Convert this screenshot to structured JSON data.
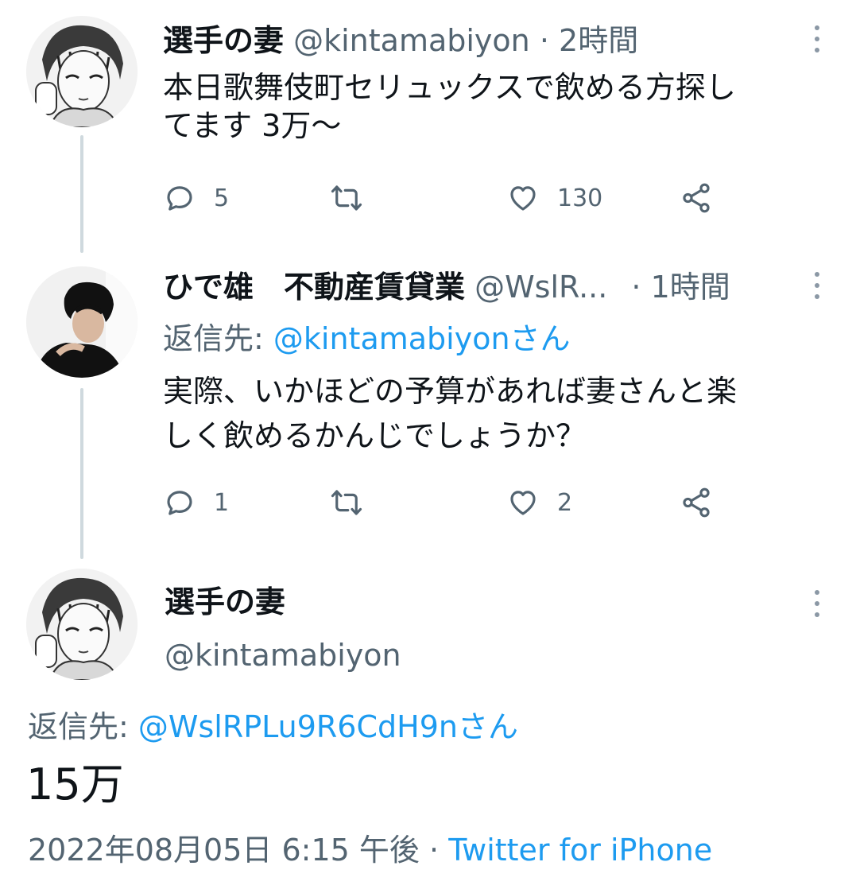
{
  "tweet1": {
    "name": "選手の妻",
    "handle": "@kintamabiyon",
    "separator": "·",
    "time": "2時間",
    "text_line1": "本日歌舞伎町セリュックスで飲める方探し",
    "text_line2": "てます 3万〜",
    "replies": "5",
    "retweets": "",
    "likes": "130"
  },
  "tweet2": {
    "name": "ひで雄　不動産賃貸業",
    "handle": "@WslR...",
    "separator": "·",
    "time": "1時間",
    "reply_prefix": "返信先: ",
    "reply_target": "@kintamabiyonさん",
    "text_line1": "実際、いかほどの予算があれば妻さんと楽",
    "text_line2": "しく飲めるかんじでしょうか？",
    "replies": "1",
    "retweets": "",
    "likes": "2"
  },
  "main_tweet": {
    "name": "選手の妻",
    "handle": "@kintamabiyon",
    "reply_prefix": "返信先: ",
    "reply_target": "@WslRPLu9R6CdH9nさん",
    "text": "15万",
    "timestamp": "2022年08月05日 6:15 午後",
    "separator": "·",
    "source": "Twitter for iPhone"
  },
  "icons": {
    "reply": "reply-icon",
    "retweet": "retweet-icon",
    "like": "heart-icon",
    "share": "share-icon",
    "more": "more-vertical-icon"
  },
  "colors": {
    "link": "#1d9bf0",
    "secondary_text": "#536471",
    "thread_line": "#cfd9de"
  }
}
